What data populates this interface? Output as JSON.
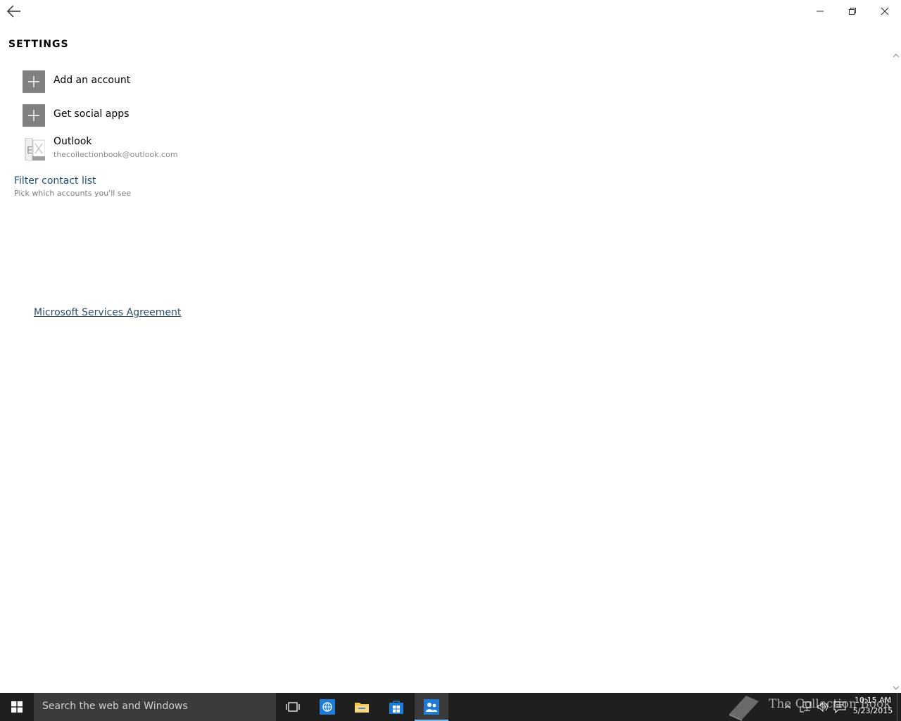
{
  "window": {
    "back_icon": "back-arrow-icon",
    "controls": [
      "minimize-icon",
      "restore-icon",
      "close-icon"
    ]
  },
  "settings": {
    "heading": "SETTINGS",
    "add_account_label": "Add an account",
    "get_social_apps_label": "Get social apps",
    "account": {
      "name": "Outlook",
      "email": "thecollectionbook@outlook.com",
      "icon": "exchange-icon"
    },
    "filter": {
      "title": "Filter contact list",
      "subtitle": "Pick which accounts you'll see"
    },
    "msa_link": "Microsoft Services Agreement"
  },
  "taskbar": {
    "search_placeholder": "Search the web and Windows",
    "apps": [
      "task-view-icon",
      "edge-browser-icon",
      "file-explorer-icon",
      "store-icon",
      "people-icon"
    ],
    "active_app": "people-icon",
    "watermark": "The Collection Book",
    "tray_icons": [
      "chevron-up-icon",
      "network-icon",
      "volume-icon",
      "action-center-icon"
    ],
    "time": "10:15 AM",
    "date": "5/23/2015"
  },
  "colors": {
    "tile_gray": "#808080",
    "link": "#1f4e79",
    "taskbar": "#1f1f1f",
    "accent": "#76b9ed"
  }
}
